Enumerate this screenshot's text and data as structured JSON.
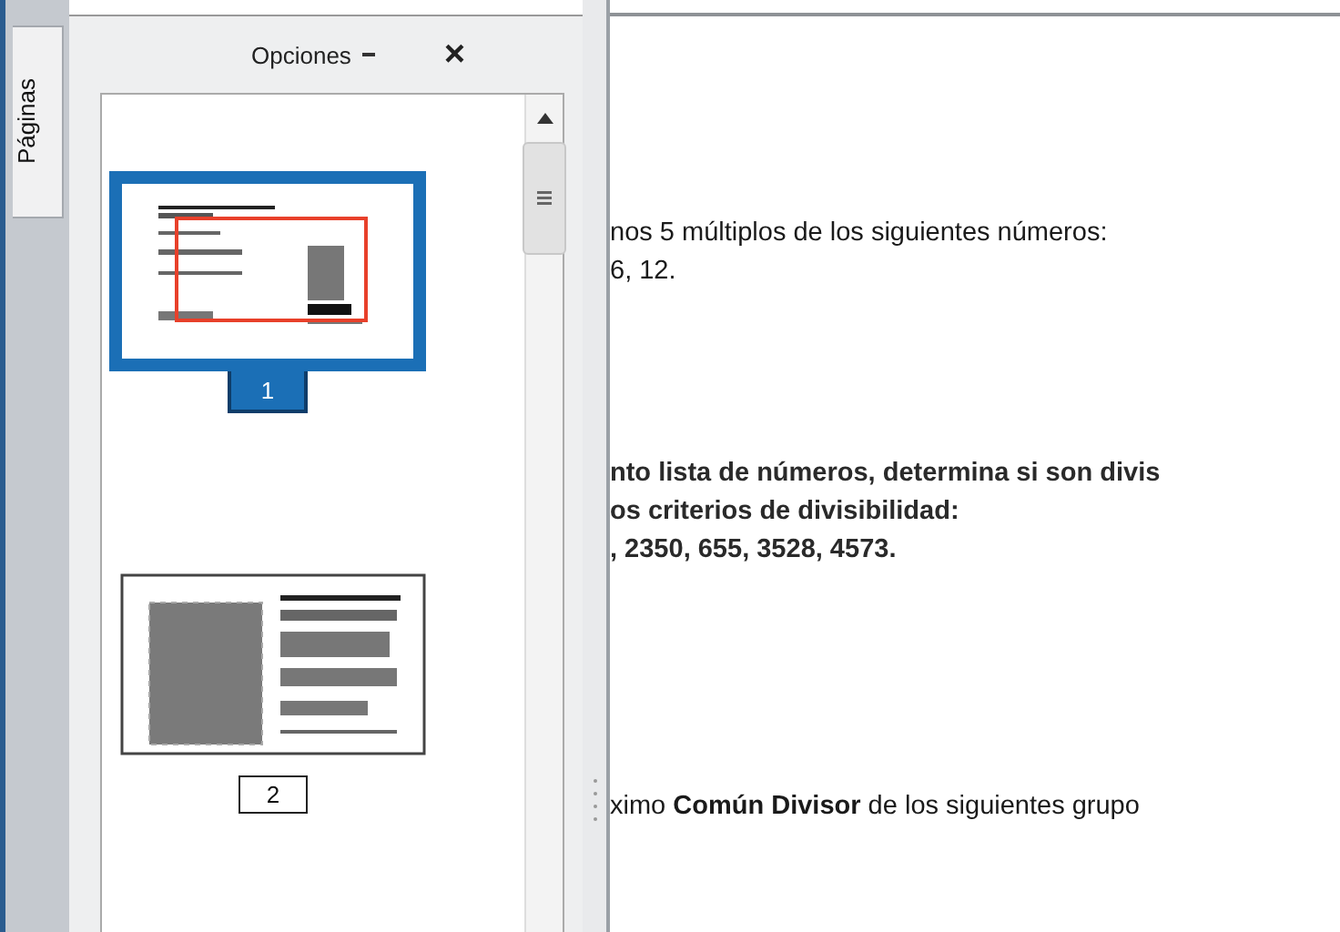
{
  "side_tabs": [
    {
      "label": "Páginas",
      "selected": true
    }
  ],
  "pages_panel": {
    "title": "Opciones",
    "close": "×",
    "pages": [
      {
        "label": "1",
        "selected": true
      },
      {
        "label": "2",
        "selected": false
      }
    ]
  },
  "document": {
    "blocks": [
      {
        "lines": [
          "nos 5  múltiplos de los siguientes números:",
          "6, 12."
        ]
      },
      {
        "lines": [
          "nto lista de números, determina si son divis",
          "os criterios de divisibilidad:",
          ",  2350, 655,  3528, 4573."
        ]
      },
      {
        "lines": [
          "ximo **Común Divisor** de los siguientes grupo"
        ]
      }
    ]
  }
}
